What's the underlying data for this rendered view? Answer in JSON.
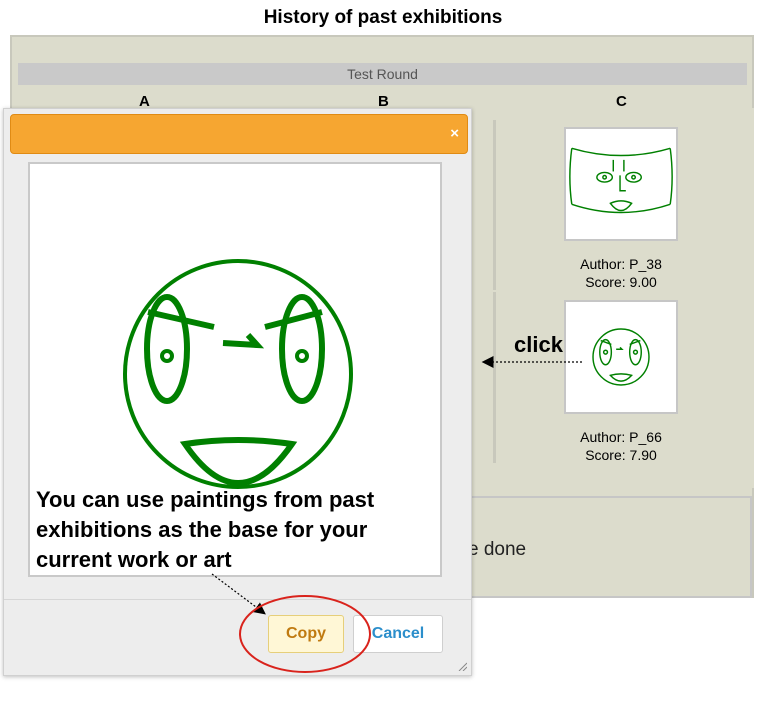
{
  "page": {
    "title": "History of past exhibitions"
  },
  "round": {
    "label": "Test Round"
  },
  "columns": [
    "A",
    "B",
    "C"
  ],
  "gallery": [
    {
      "author": "Author: P_38",
      "score": "Score: 9.00"
    },
    {
      "author": "Author: P_66",
      "score": "Score: 7.90"
    }
  ],
  "background": {
    "done_text": "e done"
  },
  "dialog": {
    "close_label": "×",
    "note": "You can use paintings from past exhibitions as the base for your current work or art",
    "copy_label": "Copy",
    "cancel_label": "Cancel"
  },
  "annotation": {
    "click_label": "click"
  },
  "colors": {
    "drawing": "#008000",
    "header": "#f6a631",
    "highlight_circle": "#d9231c"
  }
}
